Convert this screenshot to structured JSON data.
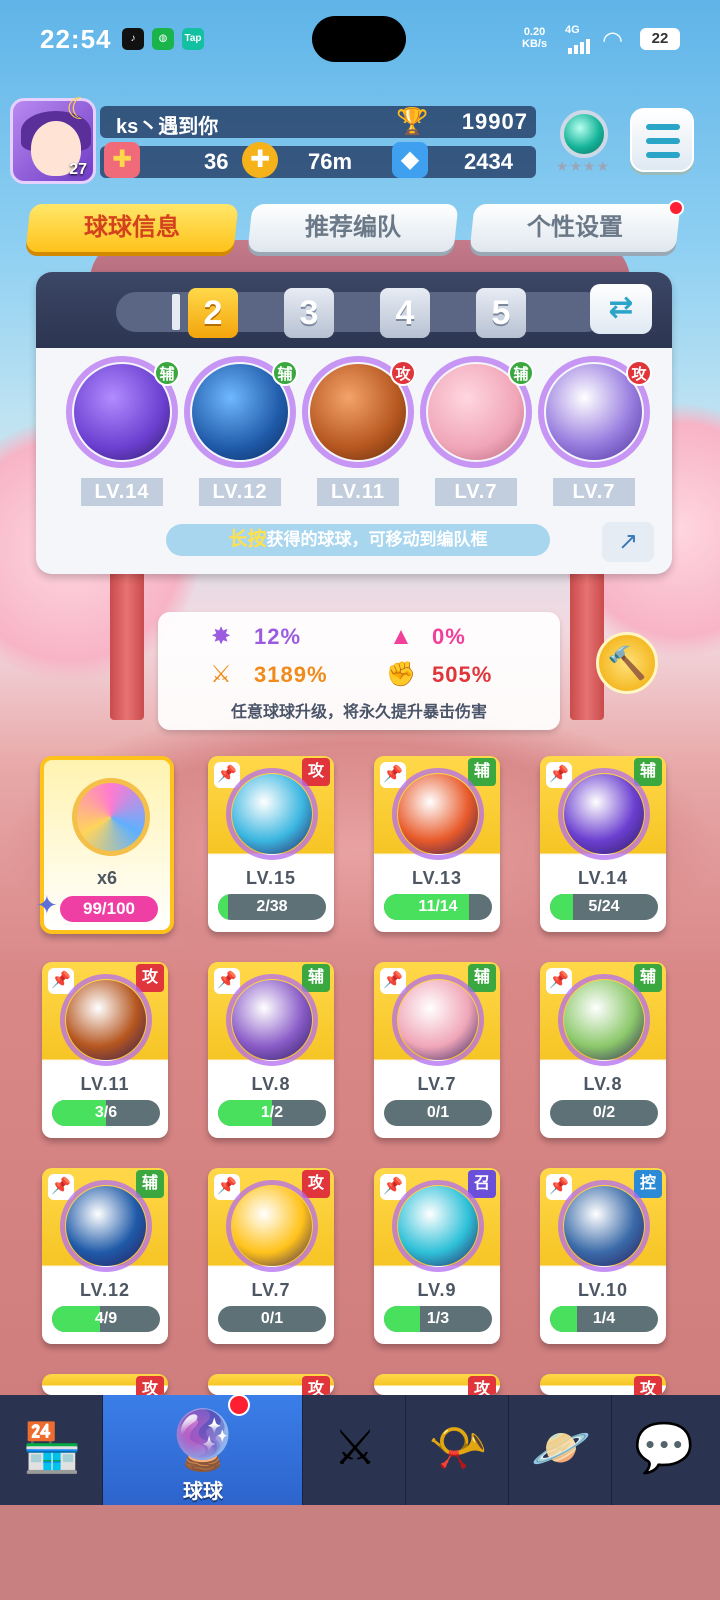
{
  "status_bar": {
    "time": "22:54",
    "net_speed": "0.20",
    "net_unit": "KB/s",
    "signal_type": "4G",
    "battery": "22",
    "tap_label": "Tap"
  },
  "profile": {
    "level": "27",
    "name": "ks丶遇到你",
    "trophies": "19907",
    "energy": "36",
    "coins": "76m",
    "gems": "2434"
  },
  "tabs": [
    {
      "label": "球球信息"
    },
    {
      "label": "推荐编队"
    },
    {
      "label": "个性设置"
    }
  ],
  "team": {
    "slots": [
      "2",
      "3",
      "4",
      "5"
    ],
    "selected_slot": "2",
    "members": [
      {
        "tag": "辅",
        "tag_type": "fu",
        "level": "LV.14",
        "color": "#6b3fd0"
      },
      {
        "tag": "辅",
        "tag_type": "fu",
        "level": "LV.12",
        "color": "#1f5aa8"
      },
      {
        "tag": "攻",
        "tag_type": "gong",
        "level": "LV.11",
        "color": "#b5561f"
      },
      {
        "tag": "辅",
        "tag_type": "fu",
        "level": "LV.7",
        "color": "#f0a6b8"
      },
      {
        "tag": "攻",
        "tag_type": "gong",
        "level": "LV.7",
        "color": "#9a7fe0"
      }
    ],
    "hint_highlight": "长按",
    "hint_text": "获得的球球，可移动到编队框"
  },
  "stats": {
    "crit_rate": "12%",
    "extra_rate": "0%",
    "crit_damage": "3189%",
    "extra_damage": "505%",
    "note": "任意球球升级，将永久提升暴击伤害"
  },
  "special_card": {
    "count": "x6",
    "progress": "99/100"
  },
  "cards": [
    {
      "tag": "攻",
      "tag_type": "gong",
      "level": "LV.15",
      "progress": "2/38",
      "fill": 0.05,
      "color": "#3bb6e0"
    },
    {
      "tag": "辅",
      "tag_type": "fu",
      "level": "LV.13",
      "progress": "11/14",
      "fill": 0.79,
      "color": "#e85a2a"
    },
    {
      "tag": "辅",
      "tag_type": "fu",
      "level": "LV.14",
      "progress": "5/24",
      "fill": 0.21,
      "color": "#6b3fd0"
    },
    {
      "tag": "攻",
      "tag_type": "gong",
      "level": "LV.11",
      "progress": "3/6",
      "fill": 0.5,
      "color": "#b5561f"
    },
    {
      "tag": "辅",
      "tag_type": "fu",
      "level": "LV.8",
      "progress": "1/2",
      "fill": 0.5,
      "color": "#8a5cc8"
    },
    {
      "tag": "辅",
      "tag_type": "fu",
      "level": "LV.7",
      "progress": "0/1",
      "fill": 0.0,
      "color": "#f0a6b8"
    },
    {
      "tag": "辅",
      "tag_type": "fu",
      "level": "LV.8",
      "progress": "0/2",
      "fill": 0.0,
      "color": "#8bc86a"
    },
    {
      "tag": "辅",
      "tag_type": "fu",
      "level": "LV.12",
      "progress": "4/9",
      "fill": 0.44,
      "color": "#1f5aa8"
    },
    {
      "tag": "攻",
      "tag_type": "gong",
      "level": "LV.7",
      "progress": "0/1",
      "fill": 0.0,
      "color": "#ffc21a"
    },
    {
      "tag": "召",
      "tag_type": "zhao",
      "level": "LV.9",
      "progress": "1/3",
      "fill": 0.33,
      "color": "#2ec0d8"
    },
    {
      "tag": "控",
      "tag_type": "kong",
      "level": "LV.10",
      "progress": "1/4",
      "fill": 0.25,
      "color": "#3a6aa8"
    }
  ],
  "peek_tags": [
    "攻",
    "攻",
    "攻",
    "攻"
  ],
  "nav": {
    "active_label": "球球"
  }
}
